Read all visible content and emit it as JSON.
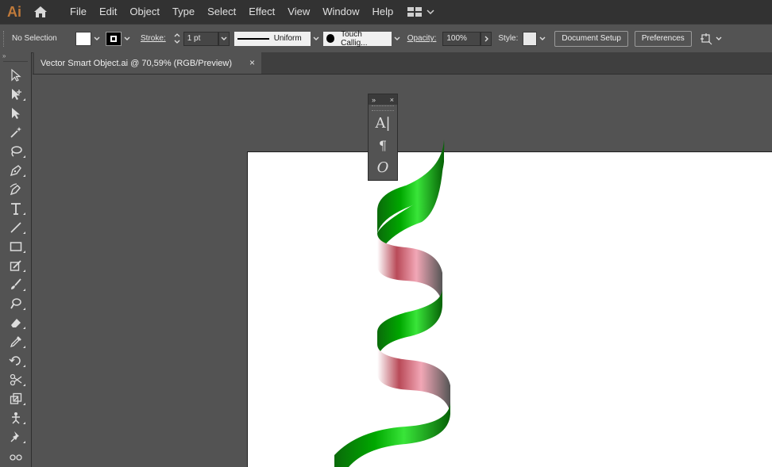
{
  "app": {
    "logo_text": "Ai",
    "accent_color": "#c07a3a"
  },
  "menu": {
    "items": [
      "File",
      "Edit",
      "Object",
      "Type",
      "Select",
      "Effect",
      "View",
      "Window",
      "Help"
    ]
  },
  "control_bar": {
    "selection_label": "No Selection",
    "stroke_label": "Stroke:",
    "stroke_weight": "1 pt",
    "stroke_profile": "Uniform",
    "brush": "Touch Callig...",
    "opacity_label": "Opacity:",
    "opacity_value": "100%",
    "style_label": "Style:",
    "document_setup": "Document Setup",
    "preferences": "Preferences"
  },
  "document": {
    "tab_title": "Vector Smart Object.ai @ 70,59% (RGB/Preview)",
    "tab_close": "×"
  },
  "tools": [
    "selection-tool-icon",
    "direct-selection-tool-icon",
    "group-selection-tool-icon",
    "magic-wand-tool-icon",
    "lasso-tool-icon",
    "pen-tool-icon",
    "curvature-tool-icon",
    "type-tool-icon",
    "line-tool-icon",
    "rectangle-tool-icon",
    "shaper-tool-icon",
    "paintbrush-tool-icon",
    "blob-brush-tool-icon",
    "eraser-tool-icon",
    "eyedropper-tool-icon",
    "rotate-tool-icon",
    "scissors-tool-icon",
    "scale-tool-icon",
    "puppet-warp-tool-icon",
    "pin-tool-icon",
    "blend-tool-icon"
  ],
  "float_panel": {
    "buttons": [
      "A|",
      "¶",
      "O"
    ],
    "collapse": "»",
    "close": "×"
  },
  "colors": {
    "ribbon_green": "#00b300",
    "ribbon_pink": "#e88ca0",
    "ribbon_red": "#b8404a"
  }
}
